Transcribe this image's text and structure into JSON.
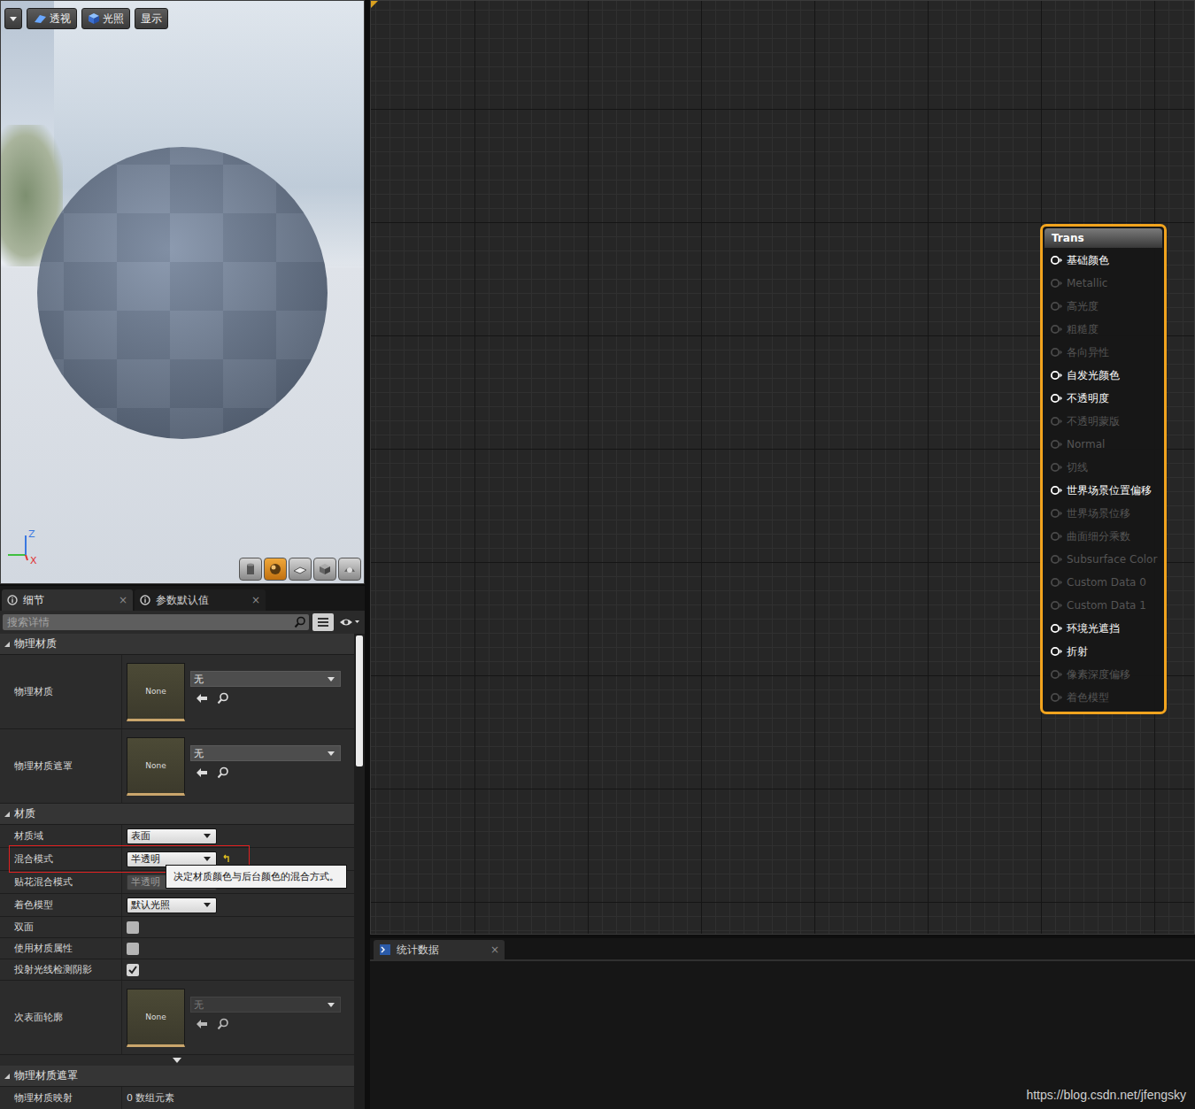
{
  "viewport": {
    "toolbar": [
      {
        "label": "透视"
      },
      {
        "label": "光照"
      },
      {
        "label": "显示"
      }
    ],
    "axes": {
      "up": "Z",
      "forward": "X"
    },
    "preview_shapes": [
      {
        "selected": false
      },
      {
        "selected": true
      },
      {
        "selected": false
      },
      {
        "selected": false
      },
      {
        "selected": false
      }
    ]
  },
  "details": {
    "tabs": [
      {
        "label": "细节",
        "close": "×",
        "selected": true
      },
      {
        "label": "参数默认值",
        "close": "×",
        "selected": false
      }
    ],
    "search": {
      "placeholder": "搜索详情"
    },
    "sections": [
      {
        "title": "物理材质",
        "expanded": true,
        "advanced": false,
        "rows": [
          {
            "kind": "asset",
            "label": "物理材质",
            "thumbnail": "None",
            "value": "无",
            "disabled": false,
            "highlighted": false,
            "modified": false
          },
          {
            "kind": "asset",
            "label": "物理材质遮罩",
            "thumbnail": "None",
            "value": "无",
            "disabled": false,
            "highlighted": false,
            "modified": false
          }
        ]
      },
      {
        "title": "材质",
        "expanded": true,
        "advanced": true,
        "rows": [
          {
            "kind": "select",
            "label": "材质域",
            "value": "表面",
            "disabled": false,
            "highlighted": false,
            "modified": false
          },
          {
            "kind": "select",
            "label": "混合模式",
            "value": "半透明",
            "disabled": false,
            "highlighted": true,
            "modified": true,
            "tooltip": "决定材质颜色与后台颜色的混合方式。"
          },
          {
            "kind": "select",
            "label": "贴花混合模式",
            "value": "半透明",
            "disabled": true,
            "highlighted": false,
            "modified": false
          },
          {
            "kind": "select",
            "label": "着色模型",
            "value": "默认光照",
            "disabled": false,
            "highlighted": false,
            "modified": false
          },
          {
            "kind": "checkbox",
            "label": "双面",
            "checked": false,
            "disabled": false,
            "highlighted": false,
            "modified": false
          },
          {
            "kind": "checkbox",
            "label": "使用材质属性",
            "checked": false,
            "disabled": false,
            "highlighted": false,
            "modified": false
          },
          {
            "kind": "checkbox",
            "label": "投射光线检测阴影",
            "checked": true,
            "disabled": false,
            "highlighted": false,
            "modified": false
          },
          {
            "kind": "asset",
            "label": "次表面轮廓",
            "thumbnail": "None",
            "value": "无",
            "disabled": true,
            "highlighted": false,
            "modified": false
          }
        ]
      },
      {
        "title": "物理材质遮罩",
        "expanded": true,
        "advanced": false,
        "rows": [
          {
            "kind": "array",
            "label": "物理材质映射",
            "value": "0 数组元素",
            "disabled": false,
            "highlighted": false,
            "modified": false
          }
        ]
      }
    ]
  },
  "graph": {
    "node": {
      "title": "Trans",
      "selected": true,
      "pins": [
        {
          "label": "基础颜色",
          "enabled": true
        },
        {
          "label": "Metallic",
          "enabled": false
        },
        {
          "label": "高光度",
          "enabled": false
        },
        {
          "label": "粗糙度",
          "enabled": false
        },
        {
          "label": "各向异性",
          "enabled": false
        },
        {
          "label": "自发光颜色",
          "enabled": true
        },
        {
          "label": "不透明度",
          "enabled": true
        },
        {
          "label": "不透明蒙版",
          "enabled": false
        },
        {
          "label": "Normal",
          "enabled": false
        },
        {
          "label": "切线",
          "enabled": false
        },
        {
          "label": "世界场景位置偏移",
          "enabled": true
        },
        {
          "label": "世界场景位移",
          "enabled": false
        },
        {
          "label": "曲面细分乘数",
          "enabled": false
        },
        {
          "label": "Subsurface Color",
          "enabled": false
        },
        {
          "label": "Custom Data 0",
          "enabled": false
        },
        {
          "label": "Custom Data 1",
          "enabled": false
        },
        {
          "label": "环境光遮挡",
          "enabled": true
        },
        {
          "label": "折射",
          "enabled": true
        },
        {
          "label": "像素深度偏移",
          "enabled": false
        },
        {
          "label": "着色模型",
          "enabled": false
        }
      ]
    }
  },
  "stats": {
    "tabs": [
      {
        "label": "统计数据",
        "close": "×",
        "selected": true
      }
    ]
  },
  "watermark": "https://blog.csdn.net/jfengsky"
}
